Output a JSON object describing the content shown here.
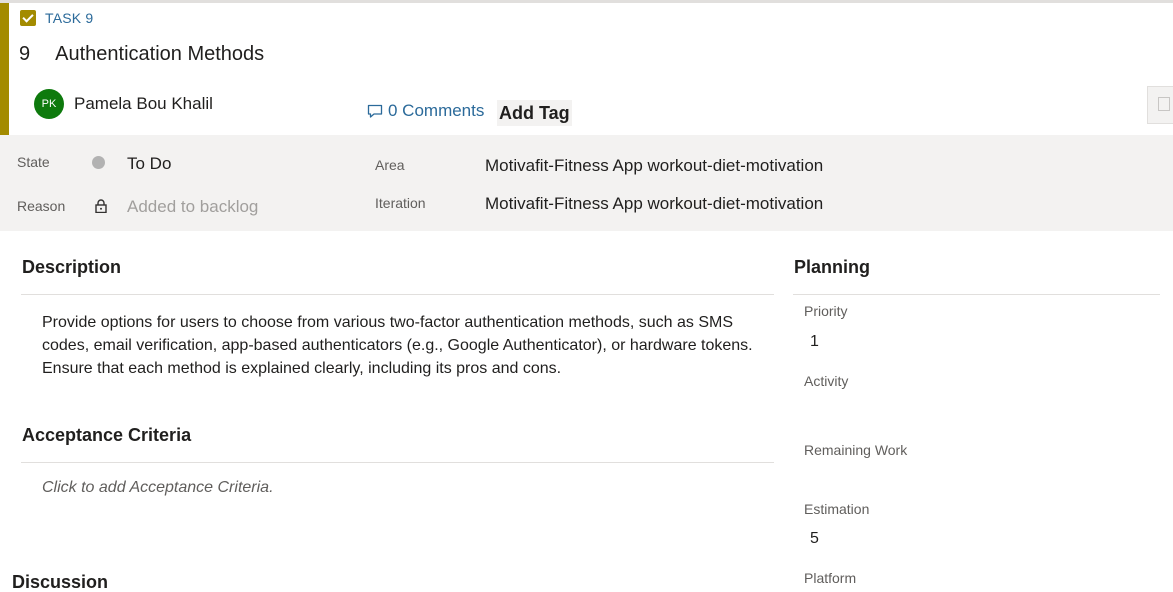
{
  "work_item": {
    "type_label": "TASK 9",
    "id": "9",
    "title": "Authentication Methods",
    "accent_color": "#a38b00"
  },
  "assignee": {
    "initials": "PK",
    "name": "Pamela Bou Khalil",
    "avatar_color": "#0e7a0d"
  },
  "toolbar": {
    "comments_label": "0 Comments",
    "add_tag_label": "Add Tag"
  },
  "fields": {
    "state_label": "State",
    "state_value": "To Do",
    "reason_label": "Reason",
    "reason_value": "Added to backlog",
    "area_label": "Area",
    "area_value": "Motivafit-Fitness App workout-diet-motivation",
    "iteration_label": "Iteration",
    "iteration_value": "Motivafit-Fitness App workout-diet-motivation"
  },
  "description": {
    "title": "Description",
    "text": "Provide options for users to choose from various two-factor authentication methods, such as SMS codes, email verification, app-based authenticators (e.g., Google Authenticator), or hardware tokens. Ensure that each method is explained clearly, including its pros and cons."
  },
  "acceptance": {
    "title": "Acceptance Criteria",
    "placeholder": "Click to add Acceptance Criteria."
  },
  "discussion": {
    "title": "Discussion"
  },
  "planning": {
    "title": "Planning",
    "priority_label": "Priority",
    "priority_value": "1",
    "activity_label": "Activity",
    "remaining_label": "Remaining Work",
    "estimation_label": "Estimation",
    "estimation_value": "5",
    "platform_label": "Platform"
  }
}
